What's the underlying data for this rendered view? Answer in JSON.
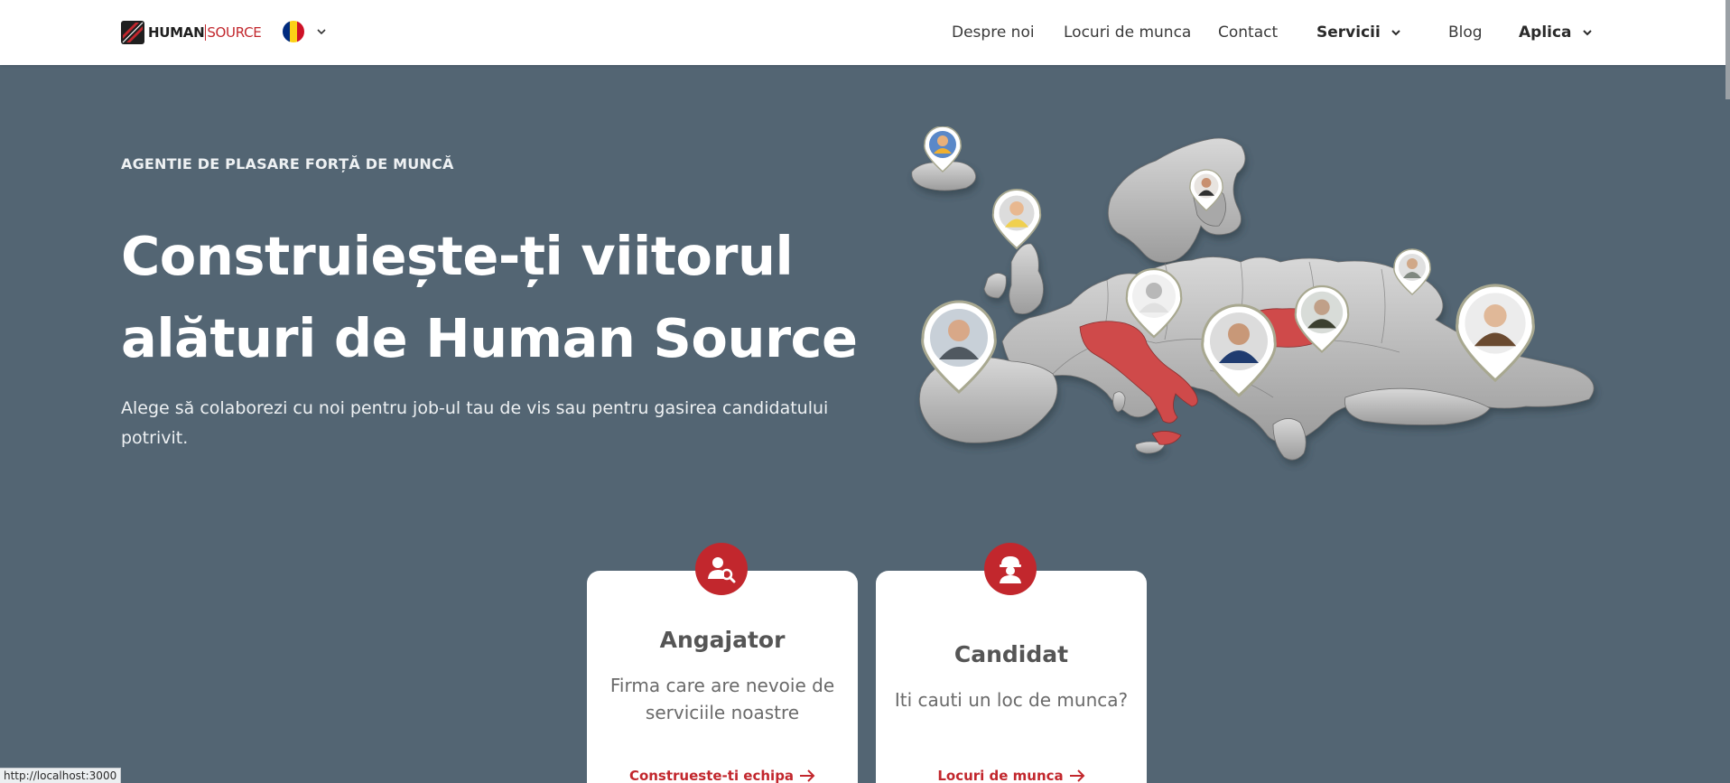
{
  "header": {
    "logo_human": "HUMAN",
    "logo_source": "SOURCE",
    "flag_colors": [
      "#002b7f",
      "#fcd116",
      "#ce1126"
    ],
    "nav": {
      "despre": "Despre noi",
      "locuri": "Locuri de munca",
      "contact": "Contact",
      "servicii": "Servicii",
      "blog": "Blog",
      "aplica": "Aplica"
    }
  },
  "hero": {
    "eyebrow": "AGENTIE DE PLASARE FORȚĂ DE MUNCĂ",
    "title": "Construiește-ți viitorul alături de Human Source",
    "subtitle": "Alege să colaborezi cu noi pentru job-ul tau de vis sau pentru gasirea candidatului potrivit."
  },
  "map": {
    "highlight_color": "#cf4a4a",
    "land_color": "#b9b9b9",
    "highlighted_countries": [
      "Italy",
      "Romania"
    ]
  },
  "cards": {
    "employer": {
      "icon": "user-search-icon",
      "title": "Angajator",
      "text": "Firma care are nevoie de serviciile noastre",
      "link": "Construeste-ti echipa"
    },
    "candidate": {
      "icon": "worker-helmet-icon",
      "title": "Candidat",
      "text": "Iti cauti un loc de munca?",
      "link": "Locuri de munca"
    }
  },
  "status_url": "http://localhost:3000",
  "colors": {
    "brand_red": "#c2272d",
    "hero_bg": "#536573"
  }
}
